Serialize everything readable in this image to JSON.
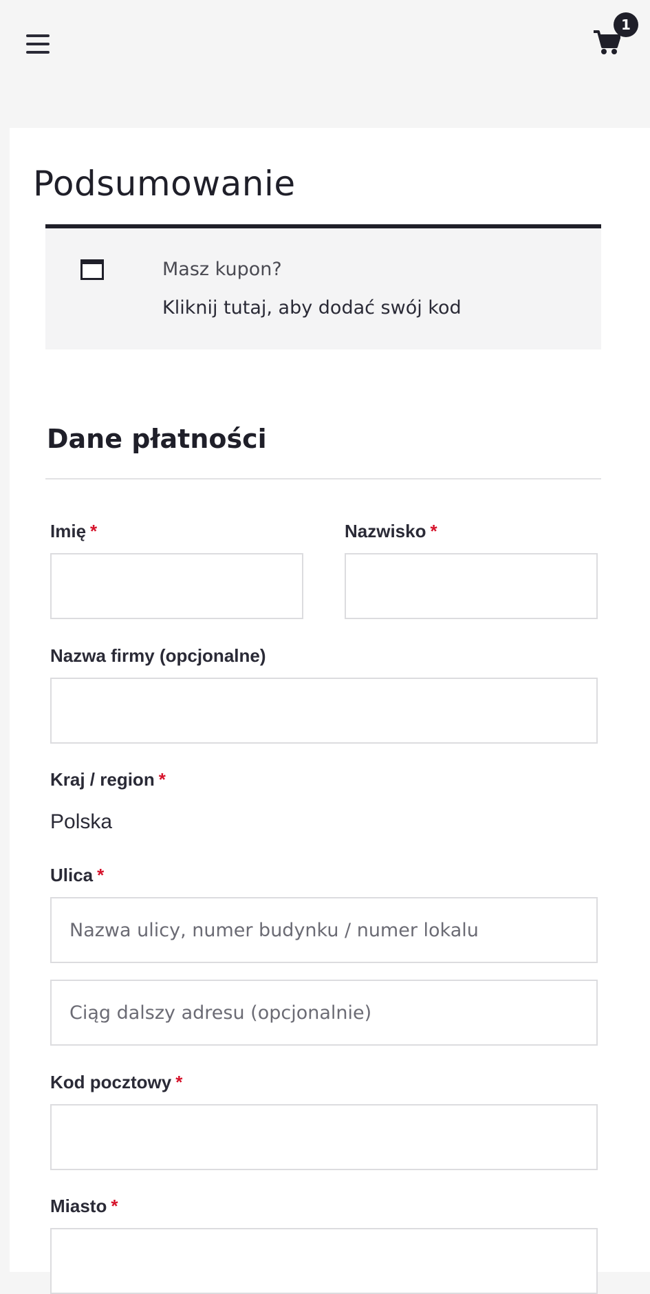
{
  "header": {
    "menu_icon": "hamburger-menu-icon",
    "cart_icon": "shopping-cart-icon",
    "cart_count": "1"
  },
  "page": {
    "title": "Podsumowanie"
  },
  "coupon": {
    "icon": "coupon-window-icon",
    "question": "Masz kupon?",
    "link": "Kliknij tutaj, aby dodać swój kod"
  },
  "billing": {
    "title": "Dane płatności",
    "required_mark": "*",
    "first_name": {
      "label": "Imię",
      "value": ""
    },
    "last_name": {
      "label": "Nazwisko",
      "value": ""
    },
    "company": {
      "label": "Nazwa firmy (opcjonalne)",
      "value": ""
    },
    "country": {
      "label": "Kraj / region",
      "value": "Polska"
    },
    "street": {
      "label": "Ulica",
      "placeholder": "Nazwa ulicy, numer budynku / numer lokalu",
      "placeholder2": "Ciąg dalszy adresu (opcjonalnie)"
    },
    "postcode": {
      "label": "Kod pocztowy",
      "value": ""
    },
    "city": {
      "label": "Miasto",
      "value": ""
    }
  },
  "colors": {
    "accent_dark": "#1f1f29",
    "required": "#d6132b",
    "page_bg": "#f5f5f5",
    "coupon_bg": "#f4f4f5"
  }
}
